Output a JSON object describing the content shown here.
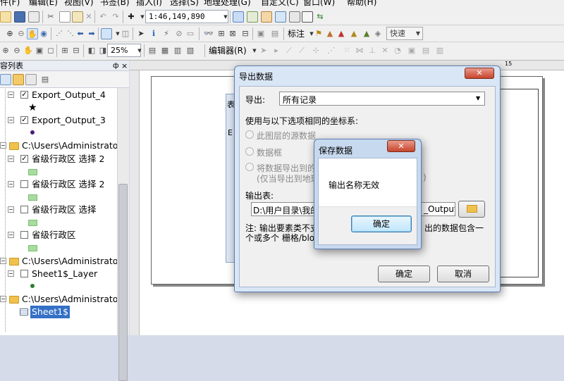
{
  "menu": [
    "件(F)",
    "编辑(E)",
    "视图(V)",
    "书签(B)",
    "插入(I)",
    "选择(S)",
    "地理处理(G)",
    "自定义(C)",
    "窗口(W)",
    "帮助(H)"
  ],
  "toolbar": {
    "scale_value": "1:46,149,890",
    "annotation_label": "标注",
    "quick_label": "快速",
    "zoom_value": "25%",
    "editor_label": "编辑器(R)"
  },
  "toc": {
    "title": "容列表",
    "pin": "ф",
    "close": "×",
    "layers": [
      {
        "label": "Export_Output_4"
      },
      {
        "label": "Export_Output_3"
      },
      {
        "label": "C:\\Users\\Administrator\\"
      },
      {
        "label": "省级行政区 选择 2"
      },
      {
        "label": "省级行政区 选择 2"
      },
      {
        "label": "省级行政区 选择"
      },
      {
        "label": "省级行政区"
      },
      {
        "label": "C:\\Users\\Administrator\\"
      },
      {
        "label": "Sheet1$_Layer"
      },
      {
        "label": "C:\\Users\\Administrator\\"
      },
      {
        "label": "Sheet1$"
      }
    ]
  },
  "layout": {
    "ruler_mark": "15"
  },
  "export_dialog": {
    "title": "导出数据",
    "export_label": "导出:",
    "export_value": "所有记录",
    "coord_label": "使用与以下选项相同的坐标系:",
    "radio1": "此图层的源数据",
    "radio2": "数据框",
    "radio3": "将数据导出到的",
    "radio3_hint": "(仅当导出到地理",
    "radio3_tail": ")",
    "output_label": "输出表:",
    "output_value": "D:\\用户目录\\我的",
    "output_tail": "_Output",
    "note_left1": "注: 输出要素类不支",
    "note_left2": "个或多个 栅格/blob",
    "note_right": "出的数据包含一",
    "ok": "确定",
    "cancel": "取消",
    "close": "✕"
  },
  "behind_fragments": [
    "表",
    "E"
  ],
  "save_dialog": {
    "title": "保存数据",
    "message": "输出名称无效",
    "ok": "确定",
    "close": "✕"
  }
}
